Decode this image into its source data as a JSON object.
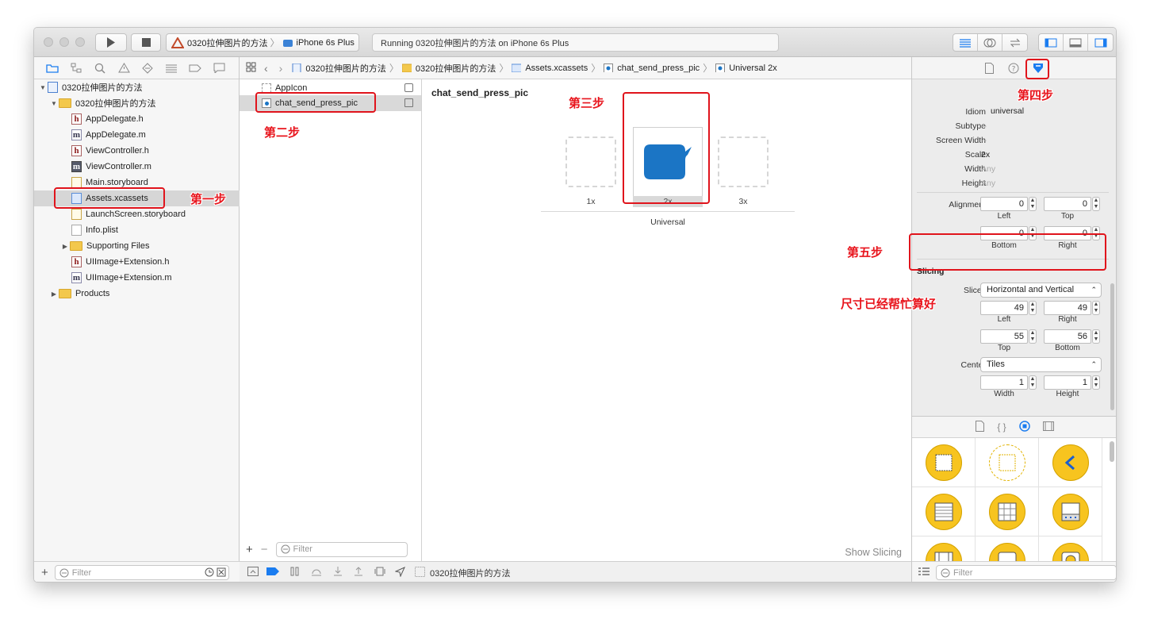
{
  "toolbar": {
    "scheme_project": "0320拉伸图片的方法",
    "scheme_device": "iPhone 6s Plus",
    "status": "Running 0320拉伸图片的方法 on iPhone 6s Plus"
  },
  "navigator": {
    "items": [
      {
        "label": "0320拉伸图片的方法",
        "icon": "project-icon"
      },
      {
        "label": "0320拉伸图片的方法",
        "icon": "folder-icon"
      },
      {
        "label": "AppDelegate.h",
        "icon": "h",
        "icon_letter": "h"
      },
      {
        "label": "AppDelegate.m",
        "icon": "m",
        "icon_letter": "m"
      },
      {
        "label": "ViewController.h",
        "icon": "h",
        "icon_letter": "h"
      },
      {
        "label": "ViewController.m",
        "icon": "m",
        "icon_letter": "m"
      },
      {
        "label": "Main.storyboard",
        "icon": "storyboard-icon"
      },
      {
        "label": "Assets.xcassets",
        "icon": "assets-icon"
      },
      {
        "label": "LaunchScreen.storyboard",
        "icon": "storyboard-icon"
      },
      {
        "label": "Info.plist",
        "icon": "plist-icon"
      },
      {
        "label": "Supporting Files",
        "icon": "folder-icon"
      },
      {
        "label": "UIImage+Extension.h",
        "icon": "h",
        "icon_letter": "h"
      },
      {
        "label": "UIImage+Extension.m",
        "icon": "m",
        "icon_letter": "m"
      },
      {
        "label": "Products",
        "icon": "folder-icon"
      }
    ],
    "filter_placeholder": "Filter"
  },
  "jumpbar": {
    "crumbs": [
      "0320拉伸图片的方法",
      "0320拉伸图片的方法",
      "Assets.xcassets",
      "chat_send_press_pic",
      "Universal 2x"
    ]
  },
  "assets": {
    "items": [
      "AppIcon",
      "chat_send_press_pic"
    ],
    "filter_placeholder": "Filter"
  },
  "canvas": {
    "title": "chat_send_press_pic",
    "slots": [
      "1x",
      "2x",
      "3x"
    ],
    "group_label": "Universal",
    "show_slicing": "Show Slicing",
    "accent": "#1b75c5"
  },
  "bottombar": {
    "target": "0320拉伸图片的方法"
  },
  "inspector": {
    "idiom_label": "Idiom",
    "idiom_value": "universal",
    "subtype_label": "Subtype",
    "subtype_value": "--",
    "screen_width_label": "Screen Width",
    "screen_width_value": "--",
    "scale_label": "Scale",
    "scale_value": "2x",
    "width_label": "Width",
    "width_value": "Any",
    "height_label": "Height",
    "height_value": "Any",
    "alignment_label": "Alignment",
    "alignment": {
      "left": "0",
      "top": "0",
      "bottom": "0",
      "right": "0"
    },
    "sub_labels": {
      "left": "Left",
      "top": "Top",
      "bottom": "Bottom",
      "right": "Right",
      "width": "Width",
      "height": "Height"
    },
    "slicing_header": "Slicing",
    "slices_label": "Slices",
    "slices_value": "Horizontal and Vertical",
    "insets": {
      "left": "49",
      "right": "49",
      "top": "55",
      "bottom": "56"
    },
    "center_label": "Center",
    "center_value": "Tiles",
    "center_size": {
      "width": "1",
      "height": "1"
    },
    "filter_placeholder": "Filter"
  },
  "annotations": {
    "step1": "第一步",
    "step2": "第二步",
    "step3": "第三步",
    "step4": "第四步",
    "step5": "第五步",
    "note": "尺寸已经帮忙算好"
  },
  "colors": {
    "annotation_red": "#e0141c",
    "library_yellow": "#f7c41f",
    "selection_blue": "#1a7cf0"
  }
}
